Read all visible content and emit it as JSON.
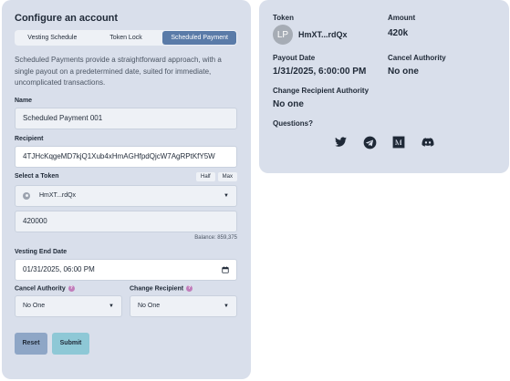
{
  "form": {
    "title": "Configure an account",
    "tabs": [
      {
        "label": "Vesting Schedule",
        "active": false
      },
      {
        "label": "Token Lock",
        "active": false
      },
      {
        "label": "Scheduled Payment",
        "active": true
      }
    ],
    "description": "Scheduled Payments provide a straightforward approach, with a single payout on a predetermined date, suited for immediate, uncomplicated transactions.",
    "name": {
      "label": "Name",
      "value": "Scheduled Payment 001"
    },
    "recipient": {
      "label": "Recipient",
      "value": "4TJHcKqgeMD7kjQ1Xub4xHmAGHfpdQjcW7AgRPtKfY5W"
    },
    "token": {
      "label": "Select a Token",
      "half_label": "Half",
      "max_label": "Max",
      "selected": "HmXT...rdQx"
    },
    "amount": {
      "value": "420000",
      "balance": "Balance: 859,375"
    },
    "vesting_end": {
      "label": "Vesting End Date",
      "value": "01/31/2025, 06:00 PM"
    },
    "cancel_authority": {
      "label": "Cancel Authority",
      "value": "No One"
    },
    "change_recipient": {
      "label": "Change Recipient",
      "value": "No One"
    },
    "buttons": {
      "reset": "Reset",
      "submit": "Submit"
    }
  },
  "summary": {
    "token_label": "Token",
    "avatar_initials": "LP",
    "token_value": "HmXT...rdQx",
    "amount_label": "Amount",
    "amount_value": "420k",
    "payout_label": "Payout Date",
    "payout_value": "1/31/2025, 6:00:00 PM",
    "cancel_label": "Cancel Authority",
    "cancel_value": "No one",
    "change_label": "Change Recipient Authority",
    "change_value": "No one",
    "questions_label": "Questions?"
  },
  "colors": {
    "card_bg": "#d9dfeb",
    "tab_active": "#5a7ba8",
    "reset_button": "#8ea6c6",
    "submit_button": "#8ec8d6",
    "help_icon": "#c17dbb"
  },
  "icons": [
    "twitter-icon",
    "telegram-icon",
    "medium-icon",
    "discord-icon"
  ]
}
